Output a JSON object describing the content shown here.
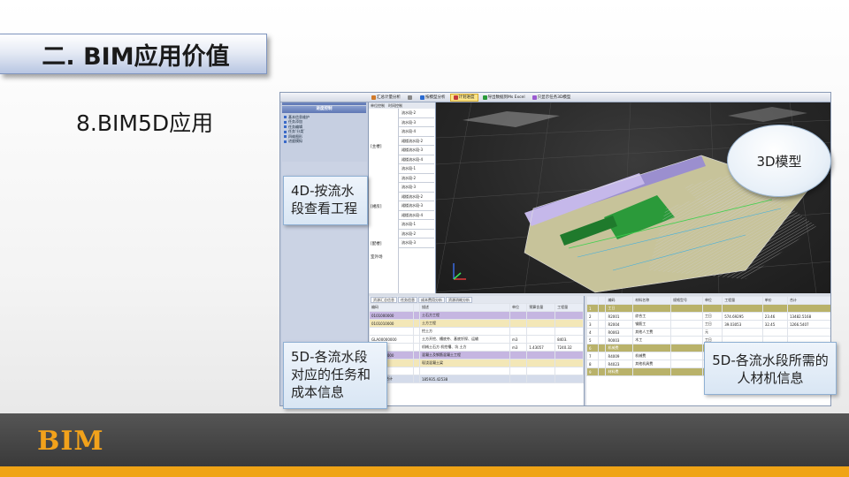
{
  "slide": {
    "section_title": "二. BIM应用价值",
    "subtitle": "8.BIM5D应用",
    "footer_logo": "BIM"
  },
  "colors": {
    "footer_bar": "#454545",
    "footer_stripe": "#f0a416",
    "logo": "#f2a21b",
    "callout_fill": "#dde8f5"
  },
  "app": {
    "toolbar": [
      {
        "label": "汇总计量分析",
        "icon": "chart-icon",
        "active": false
      },
      {
        "label": "",
        "icon": "separator",
        "active": false
      },
      {
        "label": "按模型分析",
        "icon": "model-icon",
        "active": false
      },
      {
        "label": "计划进度",
        "icon": "schedule-icon",
        "active": true
      },
      {
        "label": "导出数据到Ms Excel",
        "icon": "excel-icon",
        "active": false
      },
      {
        "label": "只显示任务3D模型",
        "icon": "filter-icon",
        "active": false
      }
    ],
    "nav": {
      "title": "任务导航栏",
      "groups": [
        "工程信息",
        "进度控制"
      ],
      "items": [
        "基本信息维护",
        "任务添加",
        "任务编辑",
        "任务‘分类’",
        "四维图形",
        "进度模拟"
      ]
    },
    "tree": {
      "tabs": [
        "单位控制",
        "时间控制"
      ],
      "phases": [
        "[主楼]",
        "[裙房]",
        "[配楼]",
        "室外场"
      ],
      "rows": [
        "流水段-2",
        "流水段-3",
        "流水段-4",
        "裙楼流水段-2",
        "裙楼流水段-3",
        "裙楼流水段-4",
        "流水段-1",
        "流水段-2",
        "流水段-3",
        "裙楼流水段-2",
        "裙楼流水段-3",
        "裙楼流水段-4",
        "流水段-1",
        "流水段-2",
        "流水段-3"
      ]
    },
    "bottom_left": {
      "tabs": [
        "资源汇总信息",
        "任务信息",
        "成本费用分析",
        "资源消耗分析"
      ],
      "headers": [
        "编码",
        "",
        "描述",
        "单位",
        "预算含量",
        "工程量"
      ],
      "rows": [
        {
          "code": "0101000000",
          "desc": "土石方工程",
          "unit": "",
          "qty": "",
          "amt": "",
          "style": "hl-purple"
        },
        {
          "code": "0101010000",
          "desc": "土方工程",
          "unit": "",
          "qty": "",
          "amt": "",
          "style": "hl-yellow"
        },
        {
          "code": "",
          "desc": "挖土方",
          "unit": "",
          "qty": "",
          "amt": "",
          "style": ""
        },
        {
          "code": "GLA00000000",
          "desc": "土方开挖、槽底夯、基底钎探、运输",
          "unit": "m3",
          "qty": "",
          "amt": "8403.",
          "style": ""
        },
        {
          "code": "1-19",
          "desc": "机械土石方 机挖槽、坑 土方",
          "unit": "m3",
          "qty": "1.43057",
          "amt": "7240.32",
          "style": ""
        },
        {
          "code": "0104000000",
          "desc": "混凝土及钢筋混凝土工程",
          "unit": "",
          "qty": "",
          "amt": "",
          "style": "hl-purple"
        },
        {
          "code": "0104000",
          "desc": "现浇混凝土梁",
          "unit": "",
          "qty": "",
          "amt": "",
          "style": "hl-yellow"
        },
        {
          "code": "",
          "desc": "",
          "unit": "",
          "qty": "",
          "amt": "",
          "style": ""
        },
        {
          "code": "任务原价合计",
          "desc": "185935.42538",
          "unit": "",
          "qty": "",
          "amt": "",
          "style": "hl-bluegray"
        }
      ]
    },
    "bottom_right": {
      "headers": [
        "",
        "",
        "编码",
        "材料名称",
        "规格型号",
        "单位",
        "工程量",
        "单价",
        "合计"
      ],
      "rows": [
        {
          "no": "1",
          "code": "工日",
          "name": "",
          "spec": "",
          "unit": "",
          "qty": "",
          "price": "",
          "total": "",
          "style": "hl-olive"
        },
        {
          "no": "2",
          "code": "R2001",
          "name": "综合工",
          "spec": "",
          "unit": "工日",
          "qty": "574.69295",
          "price": "23.46",
          "total": "13482.5168",
          "style": ""
        },
        {
          "no": "3",
          "code": "R2004",
          "name": "钢筋工",
          "spec": "",
          "unit": "工日",
          "qty": "39.03053",
          "price": "32.45",
          "total": "1266.5407",
          "style": ""
        },
        {
          "no": "4",
          "code": "R0063",
          "name": "其他人工费",
          "spec": "",
          "unit": "元",
          "qty": "",
          "price": "",
          "total": "",
          "style": ""
        },
        {
          "no": "5",
          "code": "R0003",
          "name": "木工",
          "spec": "",
          "unit": "工日",
          "qty": "",
          "price": "",
          "total": "",
          "style": ""
        },
        {
          "no": "6",
          "code": "机械费",
          "name": "",
          "spec": "",
          "unit": "",
          "qty": "",
          "price": "",
          "total": "",
          "style": "hl-olive"
        },
        {
          "no": "7",
          "code": "R4009",
          "name": "机械费",
          "spec": "",
          "unit": "元",
          "qty": "",
          "price": "",
          "total": "",
          "style": ""
        },
        {
          "no": "8",
          "code": "R4023",
          "name": "其他机具费",
          "spec": "",
          "unit": "元",
          "qty": "",
          "price": "",
          "total": "",
          "style": ""
        },
        {
          "no": "9",
          "code": "材料费",
          "name": "",
          "spec": "",
          "unit": "",
          "qty": "",
          "price": "",
          "total": "",
          "style": "hl-olive"
        }
      ]
    }
  },
  "callouts": {
    "four_d": "4D-按流水段查看工程",
    "five_d_left": "5D-各流水段对应的任务和成本信息",
    "five_d_right": "5D-各流水段所需的人材机信息",
    "three_d": "3D模型"
  }
}
